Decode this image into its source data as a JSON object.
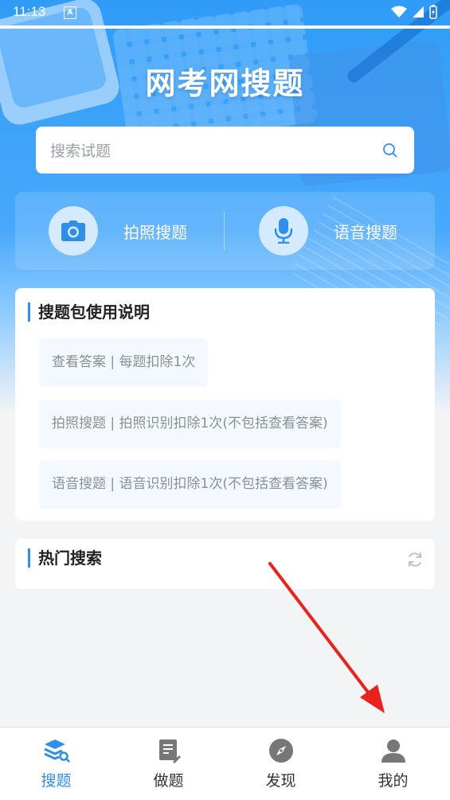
{
  "status_bar": {
    "time": "11:13",
    "notification_badge": "A"
  },
  "app": {
    "title": "网考网搜题"
  },
  "search": {
    "placeholder": "搜索试题",
    "value": "",
    "icon": "search-icon"
  },
  "quick_actions": [
    {
      "label": "拍照搜题",
      "icon": "camera-icon"
    },
    {
      "label": "语音搜题",
      "icon": "microphone-icon"
    }
  ],
  "guide": {
    "title": "搜题包使用说明",
    "items": [
      "查看答案 | 每题扣除1次",
      "拍照搜题 | 拍照识别扣除1次(不包括查看答案)",
      "语音搜题 | 语音识别扣除1次(不包括查看答案)"
    ]
  },
  "hot": {
    "title": "热门搜索",
    "icon": "refresh-icon"
  },
  "tabbar": {
    "tabs": [
      {
        "label": "搜题",
        "icon": "stack-search-icon",
        "active": true
      },
      {
        "label": "做题",
        "icon": "document-edit-icon",
        "active": false
      },
      {
        "label": "发现",
        "icon": "compass-icon",
        "active": false
      },
      {
        "label": "我的",
        "icon": "person-icon",
        "active": false
      }
    ]
  },
  "colors": {
    "primary": "#2f8ee8",
    "hero": "#2f9cf8",
    "annotation_arrow": "#e8231e"
  }
}
